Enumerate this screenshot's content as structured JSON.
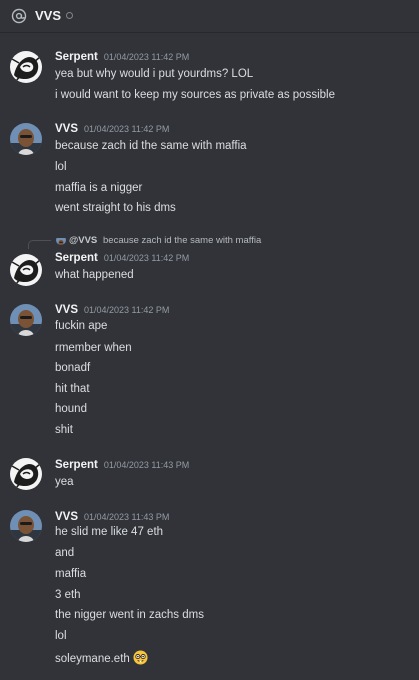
{
  "header": {
    "title": "VVS",
    "icon": "at-icon"
  },
  "colors": {
    "background": "#313338",
    "text": "#dbdee1",
    "timestamp": "#949ba4",
    "author": "#f2f3f5"
  },
  "messages": [
    {
      "author": "Serpent",
      "timestamp": "01/04/2023 11:42 PM",
      "lines": [
        "yea but why would i put yourdms? LOL",
        "i would want to keep my sources as private as possible"
      ]
    },
    {
      "author": "VVS",
      "timestamp": "01/04/2023 11:42 PM",
      "lines": [
        "because zach id the same with maffia",
        "lol",
        "maffia is a nigger",
        "went straight to his dms"
      ]
    },
    {
      "author": "Serpent",
      "timestamp": "01/04/2023 11:42 PM",
      "reply": {
        "author": "@VVS",
        "text": "because zach id the same with maffia"
      },
      "lines": [
        "what happened"
      ]
    },
    {
      "author": "VVS",
      "timestamp": "01/04/2023 11:42 PM",
      "lines": [
        "fuckin ape",
        "rmember when",
        "bonadf",
        "hit that",
        "hound",
        "shit"
      ]
    },
    {
      "author": "Serpent",
      "timestamp": "01/04/2023 11:43 PM",
      "lines": [
        "yea"
      ]
    },
    {
      "author": "VVS",
      "timestamp": "01/04/2023 11:43 PM",
      "lines": [
        "he slid me like 47 eth",
        "and",
        "maffia",
        "3 eth",
        "the nigger went in zachs dms",
        "lol",
        "soleymane.eth"
      ],
      "emoji": "nerd-face-emoji"
    }
  ]
}
